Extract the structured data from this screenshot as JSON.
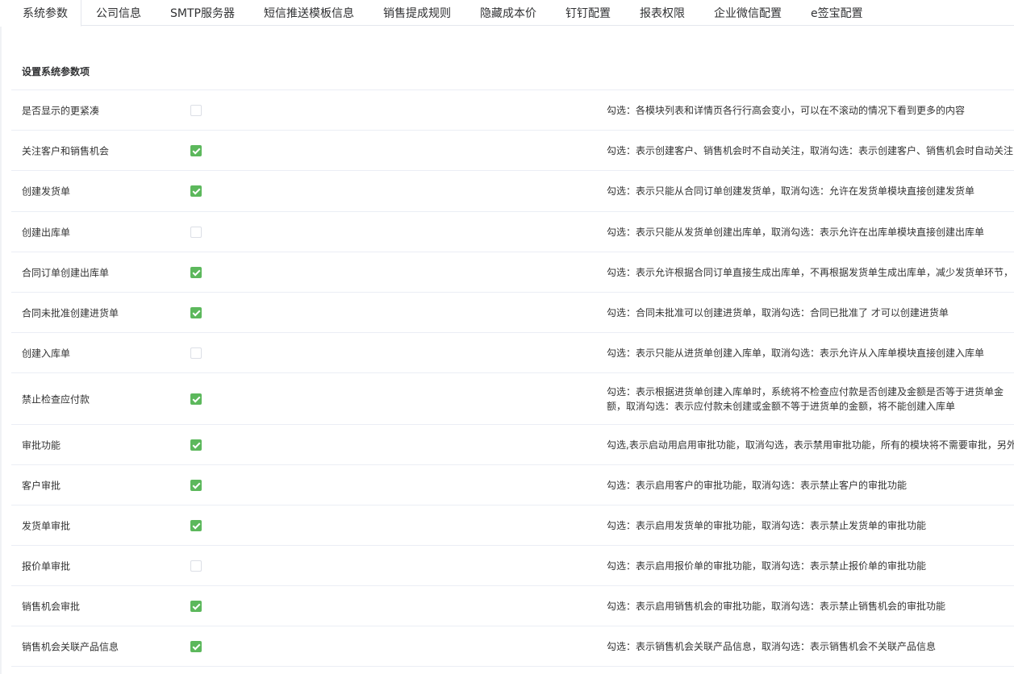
{
  "tabs": [
    {
      "label": "系统参数",
      "active": true
    },
    {
      "label": "公司信息",
      "active": false
    },
    {
      "label": "SMTP服务器",
      "active": false
    },
    {
      "label": "短信推送模板信息",
      "active": false
    },
    {
      "label": "销售提成规则",
      "active": false
    },
    {
      "label": "隐藏成本价",
      "active": false
    },
    {
      "label": "钉钉配置",
      "active": false
    },
    {
      "label": "报表权限",
      "active": false
    },
    {
      "label": "企业微信配置",
      "active": false
    },
    {
      "label": "e签宝配置",
      "active": false
    }
  ],
  "section": {
    "title": "设置系统参数项"
  },
  "settings": [
    {
      "label": "是否显示的更紧凑",
      "checked": false,
      "description": "勾选：各模块列表和详情页各行行高会变小，可以在不滚动的情况下看到更多的内容"
    },
    {
      "label": "关注客户和销售机会",
      "checked": true,
      "description": "勾选：表示创建客户、销售机会时不自动关注，取消勾选：表示创建客户、销售机会时自动关注"
    },
    {
      "label": "创建发货单",
      "checked": true,
      "description": "勾选：表示只能从合同订单创建发货单，取消勾选：允许在发货单模块直接创建发货单"
    },
    {
      "label": "创建出库单",
      "checked": false,
      "description": "勾选：表示只能从发货单创建出库单，取消勾选：表示允许在出库单模块直接创建出库单"
    },
    {
      "label": "合同订单创建出库单",
      "checked": true,
      "description": "勾选：表示允许根据合同订单直接生成出库单，不再根据发货单生成出库单，减少发货单环节，"
    },
    {
      "label": "合同未批准创建进货单",
      "checked": true,
      "description": "勾选：合同未批准可以创建进货单，取消勾选：合同已批准了 才可以创建进货单"
    },
    {
      "label": "创建入库单",
      "checked": false,
      "description": "勾选：表示只能从进货单创建入库单，取消勾选：表示允许从入库单模块直接创建入库单"
    },
    {
      "label": "禁止检查应付款",
      "checked": true,
      "description": "勾选：表示根据进货单创建入库单时，系统将不检查应付款是否创建及金额是否等于进货单金额，取消勾选：表示应付款未创建或金额不等于进货单的金额，将不能创建入库单"
    },
    {
      "label": "审批功能",
      "checked": true,
      "description": "勾选,表示启动用启用审批功能，取消勾选，表示禁用审批功能，所有的模块将不需要审批，另外"
    },
    {
      "label": "客户审批",
      "checked": true,
      "description": "勾选：表示启用客户的审批功能，取消勾选：表示禁止客户的审批功能"
    },
    {
      "label": "发货单审批",
      "checked": true,
      "description": "勾选：表示启用发货单的审批功能，取消勾选：表示禁止发货单的审批功能"
    },
    {
      "label": "报价单审批",
      "checked": false,
      "description": "勾选：表示启用报价单的审批功能，取消勾选：表示禁止报价单的审批功能"
    },
    {
      "label": "销售机会审批",
      "checked": true,
      "description": "勾选：表示启用销售机会的审批功能，取消勾选：表示禁止销售机会的审批功能"
    },
    {
      "label": "销售机会关联产品信息",
      "checked": true,
      "description": "勾选：表示销售机会关联产品信息，取消勾选：表示销售机会不关联产品信息"
    }
  ],
  "colors": {
    "checkbox_checked": "#5cb85c",
    "border": "#ebeef5",
    "text": "#333333"
  }
}
